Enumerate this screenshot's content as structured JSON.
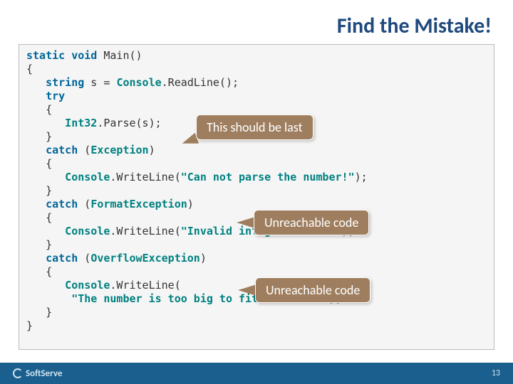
{
  "title": "Find the Mistake!",
  "code": {
    "l1a": "static",
    "l1b": "void",
    "l1c": " Main()",
    "l2": "{",
    "l3a": "   string",
    "l3b": " s = ",
    "l3c": "Console",
    "l3d": ".ReadLine();",
    "l4": "   try",
    "l5": "   {",
    "l6a": "      Int32",
    "l6b": ".Parse(s);",
    "l7": "   }",
    "l8a": "   catch",
    "l8b": " (",
    "l8c": "Exception",
    "l8d": ")",
    "l9": "   {",
    "l10a": "      Console",
    "l10b": ".WriteLine(",
    "l10c": "\"Can not parse the number!\"",
    "l10d": ");",
    "l11": "   }",
    "l12a": "   catch",
    "l12b": " (",
    "l12c": "FormatException",
    "l12d": ")",
    "l13": "   {",
    "l14a": "      Console",
    "l14b": ".WriteLine(",
    "l14c": "\"Invalid integer number!\"",
    "l14d": ");",
    "l15": "   }",
    "l16a": "   catch",
    "l16b": " (",
    "l16c": "OverflowException",
    "l16d": ")",
    "l17": "   {",
    "l18a": "      Console",
    "l18b": ".WriteLine(",
    "l19a": "       ",
    "l19b": "\"The number is too big to fit in Int32!\"",
    "l19c": ");",
    "l20": "   }",
    "l21": "}"
  },
  "callouts": {
    "c1": "This should be last",
    "c2": "Unreachable code",
    "c3": "Unreachable code"
  },
  "footer": {
    "brand": "SoftServe",
    "page": "13"
  }
}
